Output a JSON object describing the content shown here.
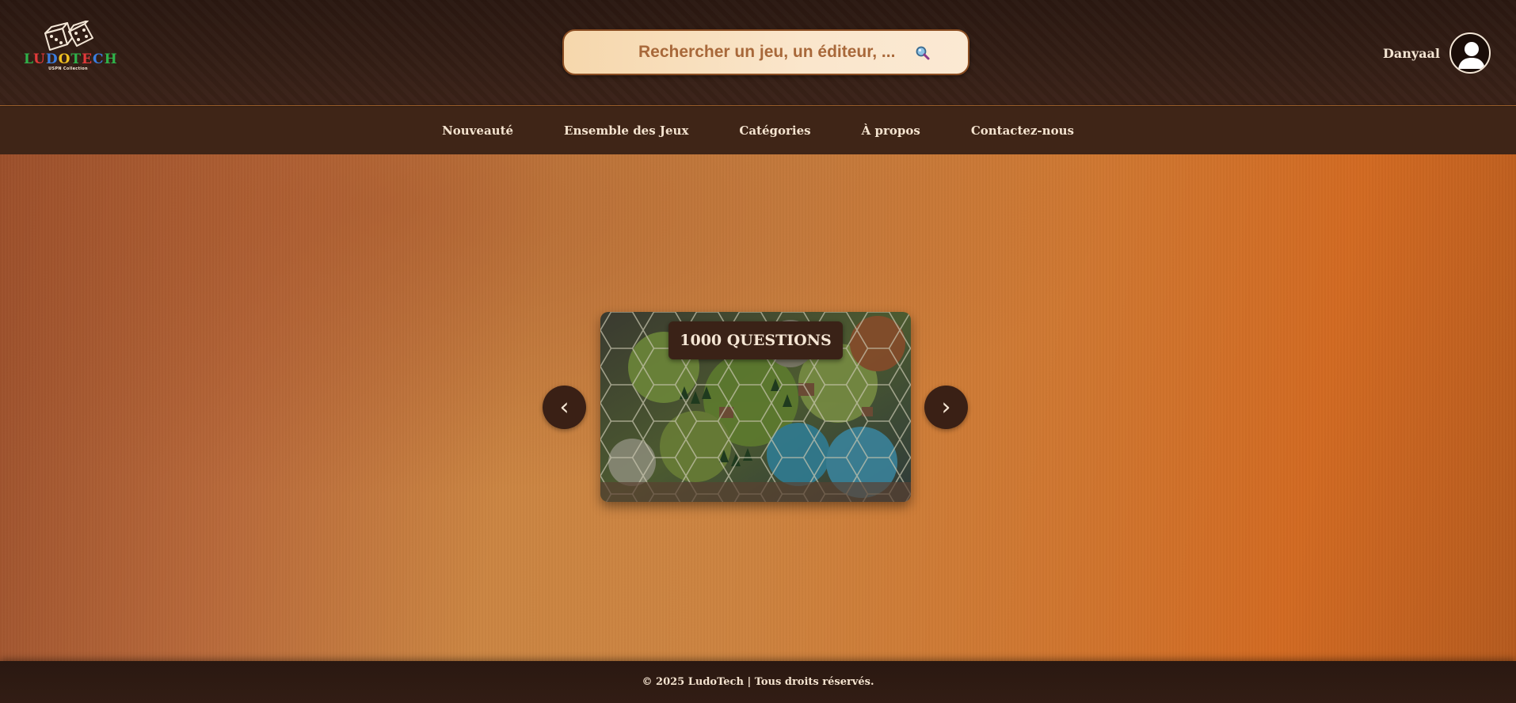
{
  "brand": {
    "name_letters": [
      "L",
      "U",
      "D",
      "O",
      "T",
      "E",
      "C",
      "H"
    ],
    "subtitle": "USPN Collection"
  },
  "search": {
    "placeholder": "Rechercher un jeu, un éditeur, ..."
  },
  "user": {
    "name": "Danyaal"
  },
  "nav": {
    "items": [
      {
        "label": "Nouveauté"
      },
      {
        "label": "Ensemble des Jeux"
      },
      {
        "label": "Catégories"
      },
      {
        "label": "À propos"
      },
      {
        "label": "Contactez-nous"
      }
    ]
  },
  "carousel": {
    "current_title": "1000 QUESTIONS",
    "prev_symbol": "‹",
    "next_symbol": "›"
  },
  "footer": {
    "text": "© 2025 LudoTech | Tous droits réservés."
  },
  "colors": {
    "header_bg": "#2a1811",
    "nav_bg": "#3f2517",
    "accent": "#cc8340",
    "text_light": "#f4e3cf"
  }
}
